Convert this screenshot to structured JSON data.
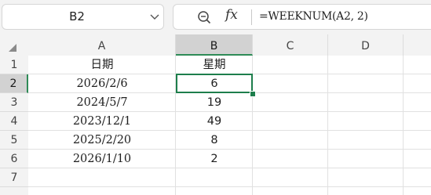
{
  "name_box": {
    "value": "B2"
  },
  "formula_bar": {
    "formula": "=WEEKNUM(A2, 2)",
    "fx_label": "fx"
  },
  "columns": [
    "A",
    "B",
    "C",
    "D"
  ],
  "rows": [
    "1",
    "2",
    "3",
    "4",
    "5",
    "6",
    "7"
  ],
  "active_cell": "B2",
  "table": {
    "headers": [
      "日期",
      "星期"
    ],
    "rows": [
      [
        "2026/2/6",
        "6"
      ],
      [
        "2024/5/7",
        "19"
      ],
      [
        "2023/12/1",
        "49"
      ],
      [
        "2025/2/20",
        "8"
      ],
      [
        "2026/1/10",
        "2"
      ]
    ]
  },
  "colors": {
    "accent": "#1e7e4c",
    "header_bg": "#f3f3f3",
    "selected_header_bg": "#d2d2d2"
  }
}
